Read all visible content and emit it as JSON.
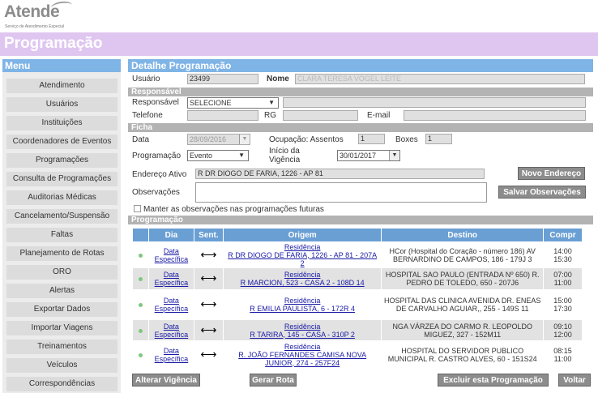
{
  "logo": {
    "word": "Atende",
    "sub": "Serviço de Atendimento Especial"
  },
  "page_title": "Programação",
  "menu": {
    "title": "Menu",
    "items": [
      "Atendimento",
      "Usuários",
      "Instituições",
      "Coordenadores de Eventos",
      "Programações",
      "Consulta de Programações",
      "Auditorias Médicas",
      "Cancelamento/Suspensão",
      "Faltas",
      "Planejamento de Rotas",
      "ORO",
      "Alertas",
      "Exportar Dados",
      "Importar Viagens",
      "Treinamentos",
      "Veículos",
      "Correspondências"
    ]
  },
  "detail": {
    "title": "Detalhe Programação",
    "usuario_label": "Usuário",
    "usuario_value": "23499",
    "nome_label": "Nome",
    "nome_value": "CLARA TERESA VOGEL LEITE",
    "responsavel_section": "Responsável",
    "responsavel_label": "Responsável",
    "responsavel_value": "SELECIONE",
    "telefone_label": "Telefone",
    "rg_label": "RG",
    "email_label": "E-mail",
    "ficha_section": "Ficha",
    "data_label": "Data",
    "data_value": "28/09/2016",
    "ocupacao_label": "Ocupação: Assentos",
    "assentos_value": "1",
    "boxes_label": "Boxes",
    "boxes_value": "1",
    "programacao_label": "Programação",
    "programacao_value": "Evento",
    "inicio_label_1": "Início da",
    "inicio_label_2": "Vigência",
    "inicio_value": "30/01/2017",
    "endereco_label": "Endereço Ativo",
    "endereco_value": "R DR DIOGO DE FARIA, 1226 - AP 81",
    "novo_endereco": "Novo Endereço",
    "observacoes_label": "Observações",
    "salvar_obs": "Salvar Observações",
    "manter_obs": "Manter as observações nas programações futuras"
  },
  "programacao": {
    "section": "Programação",
    "headers": [
      "",
      "Dia",
      "Sent.",
      "Origem",
      "Destino",
      "Compr"
    ],
    "rows": [
      {
        "dia": "Data Específica",
        "sent": "⟷",
        "origem_title": "Residência",
        "origem": "R DR DIOGO DE FARIA, 1226 - AP 81 - 207A 2",
        "destino": "HCor (Hospital do Coração - número 186) AV BERNARDINO DE CAMPOS, 186 - 179J 3",
        "compr": "14:00 15:30"
      },
      {
        "dia": "Data Específica",
        "sent": "⟷",
        "origem_title": "Residência",
        "origem": "R MARCION, 523 - CASA 2 - 108D 14",
        "destino": "HOSPITAL SAO PAULO (ENTRADA Nº 650) R. PEDRO DE TOLEDO, 650 - 207J6",
        "compr": "07:00 11:00"
      },
      {
        "dia": "Data Específica",
        "sent": "⟷",
        "origem_title": "Residência",
        "origem": "R EMILIA PAULISTA, 6 - 172R 4",
        "destino": "HOSPITAL DAS CLINICA AVENIDA DR. ENEAS DE CARVALHO AGUIAR,, 255 - 149S 11",
        "compr": "15:00 17:30"
      },
      {
        "dia": "Data Específica",
        "sent": "⟷",
        "origem_title": "Residência",
        "origem": "R TARIRA, 145 - CASA - 310P 2",
        "destino": "NGA VÁRZEA DO CARMO R. LEOPOLDO MIGUEZ, 327 - 152M11",
        "compr": "09:10 12:00"
      },
      {
        "dia": "Data Específica",
        "sent": "⟷",
        "origem_title": "Residência",
        "origem": "R. JOÃO FERNANDES CAMISA NOVA JUNIOR, 274 - 257F24",
        "destino": "HOSPITAL DO SERVIDOR PUBLICO MUNICIPAL R. CASTRO ALVES, 60 - 151S24",
        "compr": "08:15 11:00"
      }
    ]
  },
  "actions": {
    "alterar": "Alterar Vigência",
    "gerar": "Gerar Rota",
    "excluir": "Excluir esta Programação",
    "voltar": "Voltar"
  },
  "colors": {
    "banner": "#dfc6f0",
    "menu_head": "#7fb4e6",
    "table_head": "#6a9fd4"
  }
}
